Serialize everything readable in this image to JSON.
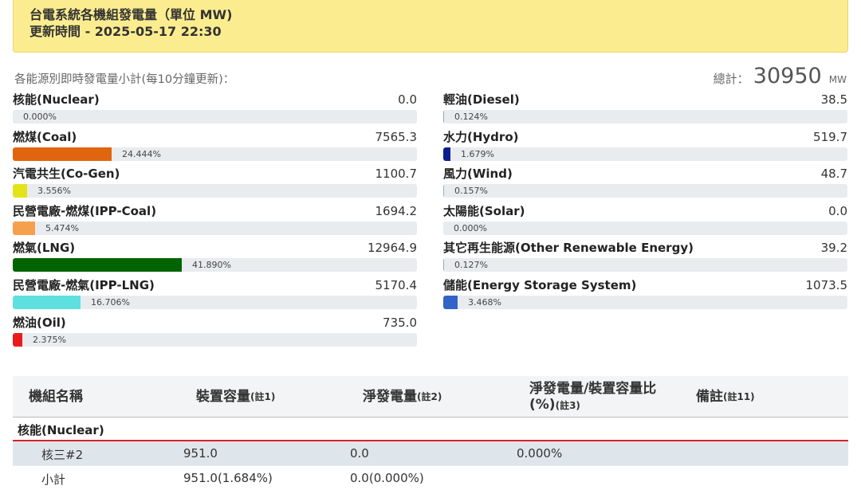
{
  "header": {
    "title": "台電系統各機組發電量（單位 MW)",
    "updated": "更新時間 - 2025-05-17 22:30"
  },
  "summary": {
    "label": "各能源別即時發電量小計(每10分鐘更新)：",
    "total_label": "總計：",
    "total_value": "30950",
    "total_unit": "MW"
  },
  "sources_left": [
    {
      "name": "核能(Nuclear)",
      "value": "0.0",
      "percent": "0.000%",
      "fraction": 0.0,
      "color": "#808080"
    },
    {
      "name": "燃煤(Coal)",
      "value": "7565.3",
      "percent": "24.444%",
      "fraction": 0.24444,
      "color": "#e0650e"
    },
    {
      "name": "汽電共生(Co-Gen)",
      "value": "1100.7",
      "percent": "3.556%",
      "fraction": 0.03556,
      "color": "#e3e31a"
    },
    {
      "name": "民營電廠-燃煤(IPP-Coal)",
      "value": "1694.2",
      "percent": "5.474%",
      "fraction": 0.05474,
      "color": "#f6a04d"
    },
    {
      "name": "燃氣(LNG)",
      "value": "12964.9",
      "percent": "41.890%",
      "fraction": 0.4189,
      "color": "#006400"
    },
    {
      "name": "民營電廠-燃氣(IPP-LNG)",
      "value": "5170.4",
      "percent": "16.706%",
      "fraction": 0.16706,
      "color": "#5ee0e0"
    },
    {
      "name": "燃油(Oil)",
      "value": "735.0",
      "percent": "2.375%",
      "fraction": 0.02375,
      "color": "#e81c1c"
    }
  ],
  "sources_right": [
    {
      "name": "輕油(Diesel)",
      "value": "38.5",
      "percent": "0.124%",
      "fraction": 0.00124,
      "color": "#9aa7b5"
    },
    {
      "name": "水力(Hydro)",
      "value": "519.7",
      "percent": "1.679%",
      "fraction": 0.01679,
      "color": "#0a1f8f"
    },
    {
      "name": "風力(Wind)",
      "value": "48.7",
      "percent": "0.157%",
      "fraction": 0.00157,
      "color": "#9ab0c8"
    },
    {
      "name": "太陽能(Solar)",
      "value": "0.0",
      "percent": "0.000%",
      "fraction": 0.0,
      "color": "#f0c419"
    },
    {
      "name": "其它再生能源(Other Renewable Energy)",
      "value": "39.2",
      "percent": "0.127%",
      "fraction": 0.00127,
      "color": "#9aa7b5"
    },
    {
      "name": "儲能(Energy Storage System)",
      "value": "1073.5",
      "percent": "3.468%",
      "fraction": 0.03468,
      "color": "#3264c8"
    }
  ],
  "table": {
    "headers": [
      {
        "label": "機組名稱",
        "note": ""
      },
      {
        "label": "裝置容量",
        "note": "(註1)"
      },
      {
        "label": "淨發電量",
        "note": "(註2)"
      },
      {
        "label": "淨發電量/裝置容量比(%)",
        "note": "(註3)"
      },
      {
        "label": "備註",
        "note": "(註11)"
      }
    ],
    "group": "核能(Nuclear)",
    "rows": [
      {
        "name": "核三#2",
        "capacity": "951.0",
        "net": "0.0",
        "ratio": "0.000%"
      },
      {
        "name": "小計",
        "capacity": "951.0(1.684%)",
        "net": "0.0(0.000%)",
        "ratio": ""
      }
    ]
  }
}
